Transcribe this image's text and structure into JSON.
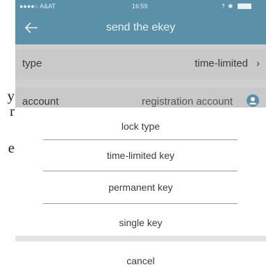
{
  "left_text": {
    "chars": [
      "y",
      "r",
      "e"
    ]
  },
  "status_bar": {
    "carrier": "●●●●○ A&AT",
    "time": "16:59",
    "battery_area": "⇡ ✱"
  },
  "nav": {
    "title": "send the ekey",
    "back_icon": "back-arrow-icon"
  },
  "form": {
    "type": {
      "label": "type",
      "value": "time-limited",
      "chevron": "›"
    },
    "account": {
      "label": "account",
      "placeholder": "registration account",
      "icon": "user-icon"
    }
  },
  "sheet": {
    "title": "lock type",
    "options": [
      "time-limited key",
      "permanent key",
      "single key"
    ],
    "cancel": "cancel"
  },
  "colors": {
    "nav": "#5a90a8",
    "overlay_row": "#c9c9c9",
    "sheet": "#ffffff"
  }
}
